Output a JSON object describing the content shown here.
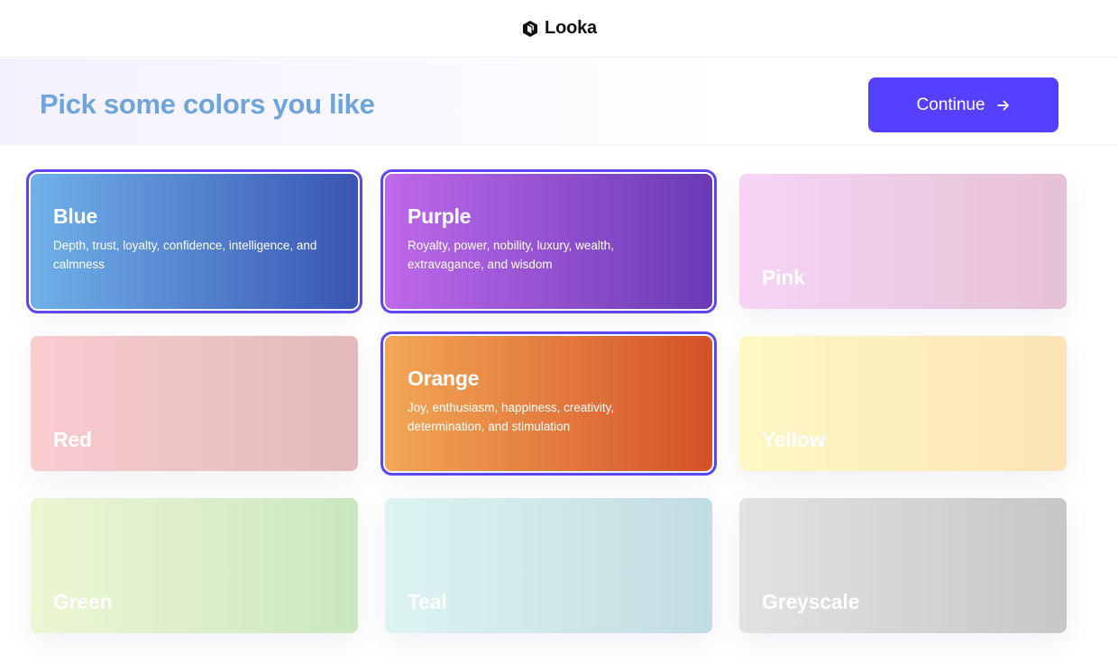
{
  "app": {
    "brand_name": "Looka"
  },
  "header": {
    "title": "Pick some colors you like",
    "continue_label": "Continue"
  },
  "colors": [
    {
      "name": "Blue",
      "selected": true,
      "description": "Depth, trust, loyalty, confidence, intelligence, and calmness",
      "gradient": [
        "#6fb1e9",
        "#3a55b4"
      ]
    },
    {
      "name": "Purple",
      "selected": true,
      "description": "Royalty, power, nobility, luxury, wealth, extravagance, and wisdom",
      "gradient": [
        "#bd69ea",
        "#6a3ab6"
      ]
    },
    {
      "name": "Pink",
      "selected": false,
      "description": "",
      "gradient": [
        "#f7d4f6",
        "#e6c1d5"
      ]
    },
    {
      "name": "Red",
      "selected": false,
      "description": "",
      "gradient": [
        "#f9cccf",
        "#e2bab8"
      ]
    },
    {
      "name": "Orange",
      "selected": true,
      "description": "Joy, enthusiasm, happiness, creativity, determination, and stimulation",
      "gradient": [
        "#f2a755",
        "#d55128"
      ]
    },
    {
      "name": "Yellow",
      "selected": false,
      "description": "",
      "gradient": [
        "#fdf8c4",
        "#fbe4b6"
      ]
    },
    {
      "name": "Green",
      "selected": false,
      "description": "",
      "gradient": [
        "#ecf7d2",
        "#cbe7c0"
      ]
    },
    {
      "name": "Teal",
      "selected": false,
      "description": "",
      "gradient": [
        "#dcf4f1",
        "#c1dce3"
      ]
    },
    {
      "name": "Greyscale",
      "selected": false,
      "description": "",
      "gradient": [
        "#e2e2e2",
        "#c7c7c7"
      ]
    }
  ],
  "theme": {
    "accent": "#5640ff",
    "selection_outline": "#5b46f0",
    "title_color": "#6ea4dc"
  }
}
